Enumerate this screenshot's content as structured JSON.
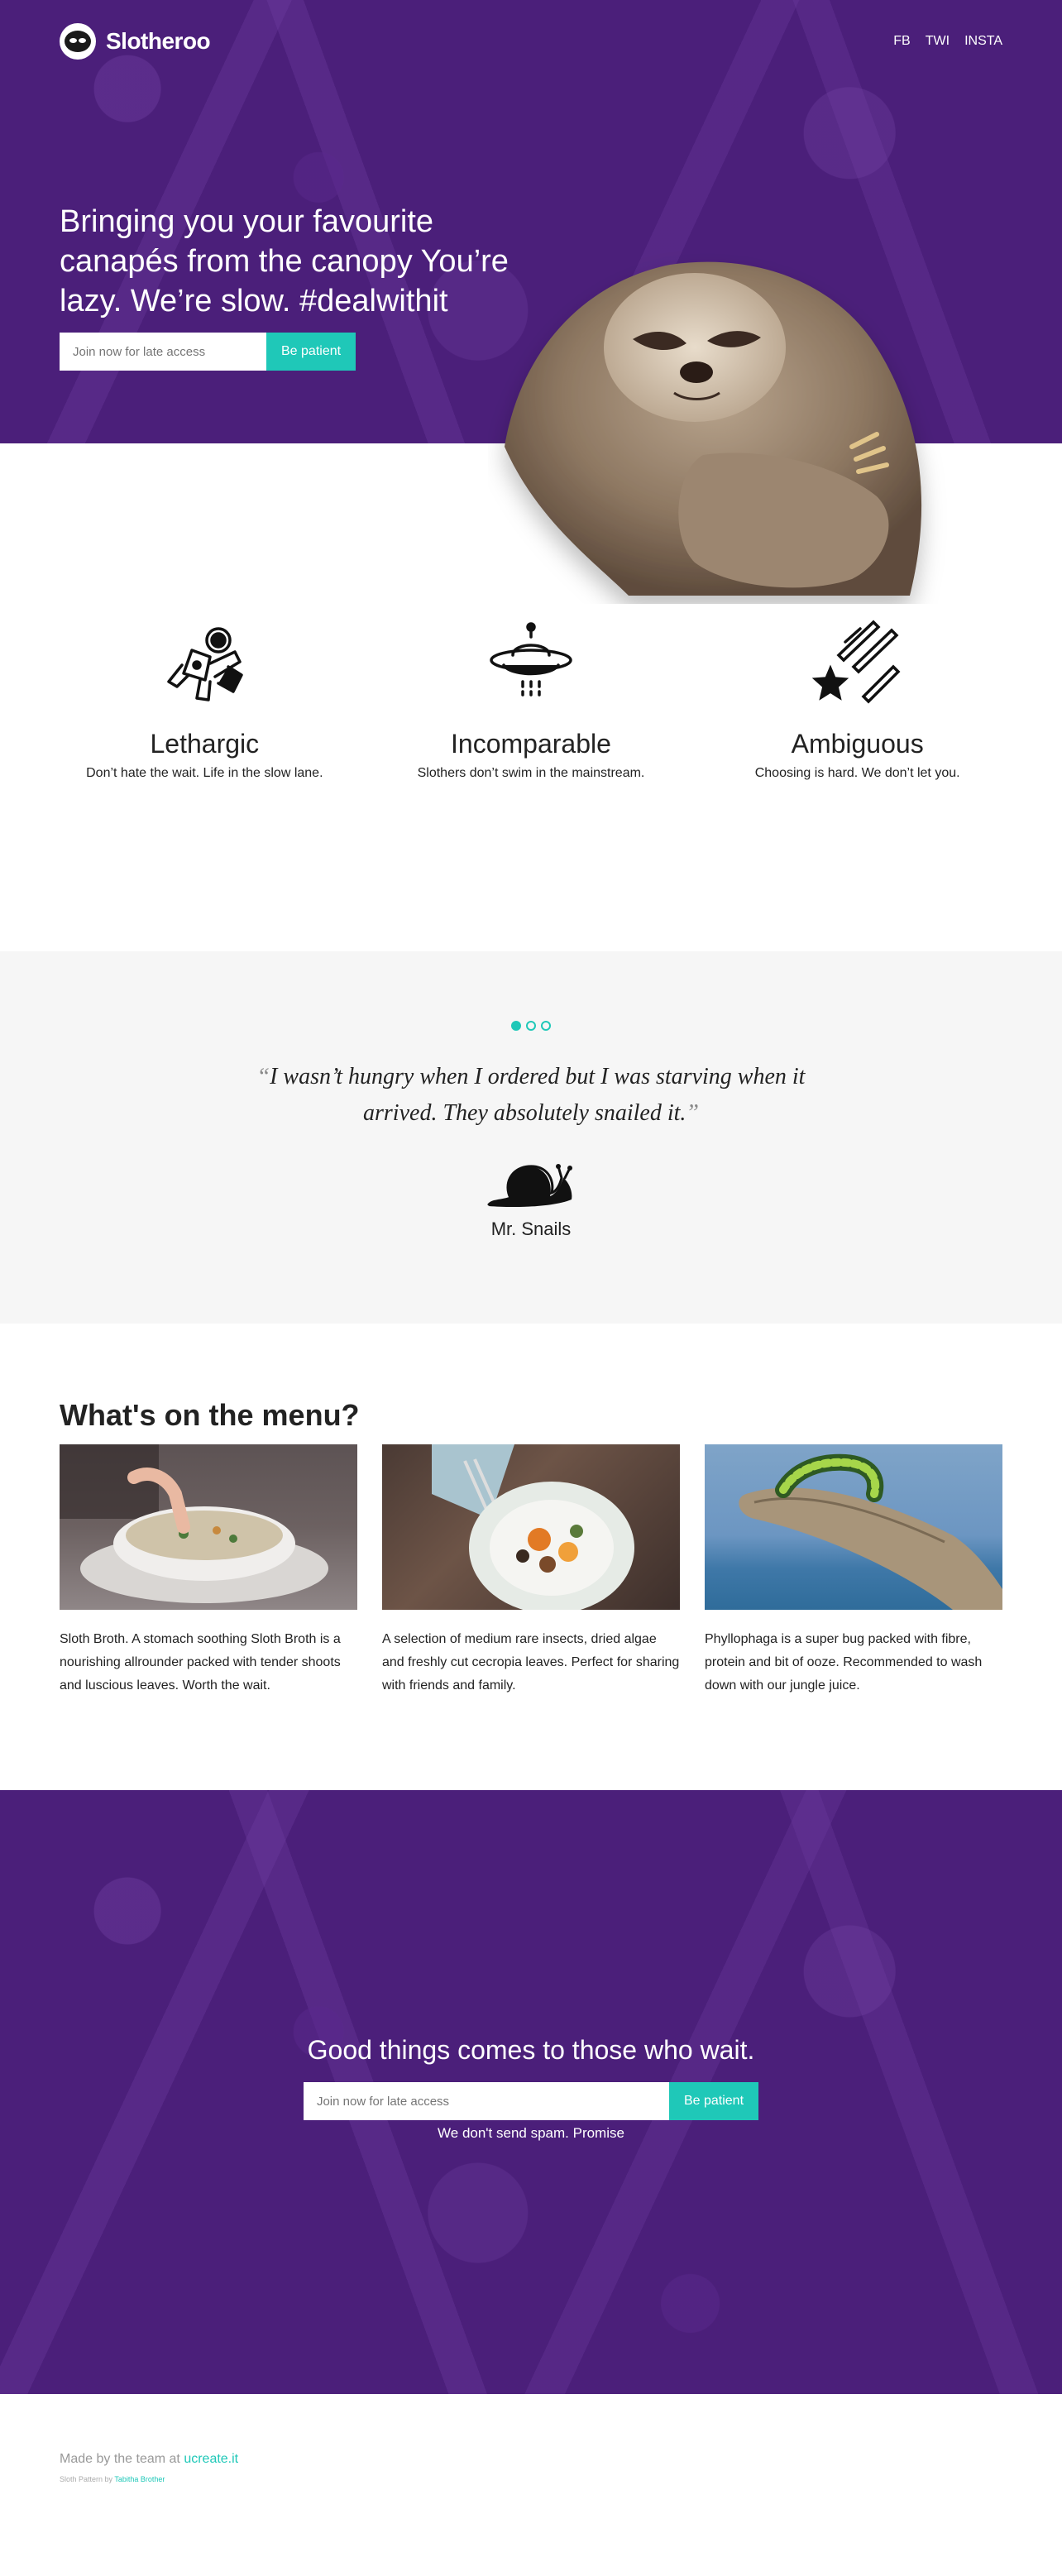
{
  "brand": {
    "name": "Slotheroo"
  },
  "social": [
    "FB",
    "TWI",
    "INSTA"
  ],
  "hero": {
    "headline": "Bringing you your favourite canapés from the canopy You’re lazy. We’re slow. #dealwithit",
    "input_placeholder": "Join now for late access",
    "button_label": "Be patient"
  },
  "features": [
    {
      "title": "Lethargic",
      "text": "Don’t hate the wait. Life in the slow lane.",
      "icon": "astronaut-icon"
    },
    {
      "title": "Incomparable",
      "text": "Slothers don’t swim in the mainstream.",
      "icon": "ufo-icon"
    },
    {
      "title": "Ambiguous",
      "text": "Choosing is hard. We don’t let you.",
      "icon": "shooting-stars-icon"
    }
  ],
  "testimonial": {
    "quote": "I wasn’t hungry when I ordered but I was starving when it arrived. They absolutely snailed it.",
    "open_mark": "“",
    "close_mark": "”",
    "author": "Mr. Snails",
    "slides": 3,
    "active_slide": 0
  },
  "menu": {
    "title": "What's on the menu?",
    "items": [
      {
        "text": "Sloth Broth. A stomach soothing Sloth Broth is a nourishing allrounder packed with tender shoots and luscious leaves. Worth the wait."
      },
      {
        "text": "A selection of medium rare insects, dried algae and freshly cut cecropia leaves. Perfect for sharing with friends and family."
      },
      {
        "text": "Phyllophaga is a super bug packed with fibre, protein and bit of ooze. Recommended to wash down with our jungle juice."
      }
    ]
  },
  "cta": {
    "title": "Good things comes to those who wait.",
    "input_placeholder": "Join now for late access",
    "button_label": "Be patient",
    "note": "We don't send spam. Promise"
  },
  "footer": {
    "made_prefix": "Made by the team at",
    "made_link": "ucreate.it",
    "credit_prefix": "Sloth Pattern by",
    "credit_link": "Tabitha Brother"
  },
  "colors": {
    "purple": "#4b1f7a",
    "accent": "#1fc8b8",
    "grey_bg": "#f6f6f6"
  }
}
